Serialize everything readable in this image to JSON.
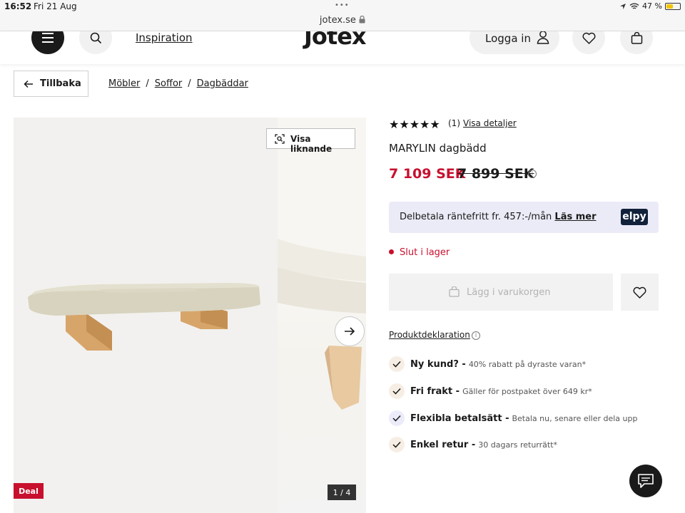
{
  "status_bar": {
    "time": "16:52",
    "date": "Fri 21 Aug",
    "url": "jotex.se",
    "battery": "47 %",
    "lock_icon": "lock-icon"
  },
  "header": {
    "logo": "Jotex",
    "inspiration": "Inspiration",
    "login": "Logga in",
    "icons": [
      "hamburger-menu-icon",
      "search-icon",
      "user-icon",
      "heart-icon",
      "shopping-bag-icon"
    ]
  },
  "nav": {
    "back": "Tillbaka",
    "breadcrumbs": [
      "Möbler",
      "Soffor",
      "Dagbäddar"
    ],
    "separator": "/"
  },
  "gallery": {
    "similar": "Visa liknande",
    "deal": "Deal",
    "counter": "1 / 4",
    "current_slide": 1,
    "total_slides": 4
  },
  "product": {
    "stars": "★★★★★",
    "rating": 5,
    "review_count": "(1)",
    "details_link": "Visa detaljer",
    "name": "MARYLIN dagbädd",
    "price": "7 109 SEK",
    "old_price": "7 899 SEK",
    "installment_text": "Delbetala räntefritt fr. 457:-/mån",
    "installment_link": "Läs mer",
    "installment_logo": "elpy",
    "stock": "Slut i lager",
    "add_to_cart": "Lägg i varukorgen",
    "declaration": "Produktdeklaration"
  },
  "usps": [
    {
      "title": "Ny kund? -",
      "sub": "40% rabatt på dyraste varan*"
    },
    {
      "title": "Fri frakt -",
      "sub": "Gäller för postpaket över 649 kr*"
    },
    {
      "title": "Flexibla betalsätt -",
      "sub": "Betala nu, senare eller dela upp"
    },
    {
      "title": "Enkel retur -",
      "sub": "30 dagars returrätt*"
    }
  ],
  "colors": {
    "accent": "#c8102e",
    "dark": "#1a1a1a",
    "elpy_bg": "#ebebf7",
    "elpy_logo": "#13223b",
    "check_bg": "#f6eee4",
    "check_bg_alt": "#ecebfa"
  }
}
